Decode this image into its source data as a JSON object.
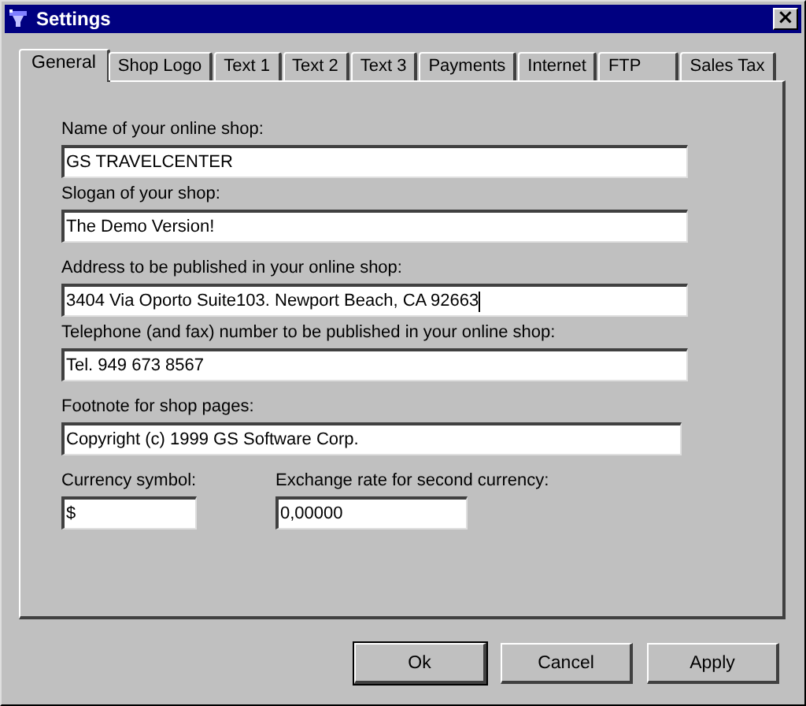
{
  "window": {
    "title": "Settings",
    "close": "×"
  },
  "tabs": [
    {
      "label": "General",
      "selected": true
    },
    {
      "label": "Shop Logo",
      "selected": false
    },
    {
      "label": "Text 1",
      "selected": false
    },
    {
      "label": "Text 2",
      "selected": false
    },
    {
      "label": "Text 3",
      "selected": false
    },
    {
      "label": "Payments",
      "selected": false
    },
    {
      "label": "Internet",
      "selected": false
    },
    {
      "label": "FTP",
      "selected": false
    },
    {
      "label": "Sales Tax",
      "selected": false
    }
  ],
  "fields": [
    {
      "label": "Name of your online shop:",
      "value": "GS TRAVELCENTER",
      "focused": false
    },
    {
      "label": "Slogan of your shop:",
      "value": "The Demo Version!",
      "focused": false
    },
    {
      "label": "Address to be published in your online shop:",
      "value": "3404 Via Oporto Suite103. Newport Beach, CA 92663",
      "focused": true
    },
    {
      "label": "Telephone (and fax) number to be published in your online shop:",
      "value": "Tel. 949 673 8567",
      "focused": false
    },
    {
      "label": "Footnote for shop pages:",
      "value": "Copyright (c) 1999 GS Software Corp.",
      "focused": false
    }
  ],
  "currency_fields": [
    {
      "label": "Currency symbol:",
      "value": "$",
      "focused": false
    },
    {
      "label": "Exchange rate for second currency:",
      "value": "0,00000",
      "focused": false
    }
  ],
  "buttons": [
    {
      "label": "Ok",
      "default": true
    },
    {
      "label": "Cancel",
      "default": false
    },
    {
      "label": "Apply",
      "default": false
    }
  ]
}
